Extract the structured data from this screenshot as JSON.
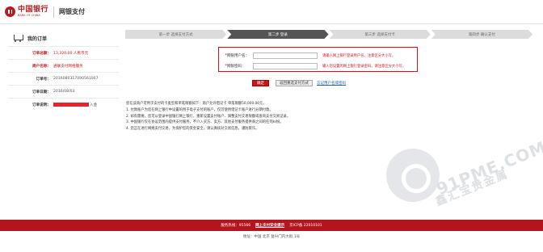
{
  "header": {
    "logo_cn": "中国银行",
    "logo_en": "BANK OF CHINA",
    "title": "网银支付"
  },
  "order": {
    "title": "我的订单",
    "rows": [
      {
        "label": "订单总额：",
        "value": "13,320.00 人民币元"
      },
      {
        "label": "商户名称：",
        "value": "通联支付网络服务"
      },
      {
        "label": "订单号：",
        "value": "2016080317090561007"
      },
      {
        "label": "订单日期：",
        "value": "2016/08/03"
      },
      {
        "label": "订单说明：",
        "value": "入金"
      }
    ]
  },
  "steps": [
    "第一步 选择支付方式",
    "第二步 登录",
    "第三步 选择支付卡",
    "第四步 确认支付"
  ],
  "login": {
    "username_label": "网银用户名：",
    "username_hint": "请输入网上银行登录用户名，注意区分大小写。",
    "password_label": "网银密码：",
    "password_hint": "输入您设置的网上银行登录密码，请注意区分大小写。",
    "confirm_label": "确定",
    "back_label": "返回重选支付方式",
    "forgot_label": "忘记用户名或密码"
  },
  "notice": [
    "您在该商户可用于支付的卡类型和单笔限额如下：商户允许借记卡 单笔限额50,000.00元。",
    "1. 付款账户为您在网上银行中设置的用于电子支付的账户，仅可使用借记卡账户进行分期付款。",
    "2. 如有需要，您可以登录中国银行网上银行，重新设置支付账户、调整支付交易限额或查询支付交易记录。",
    "3. 中国银行仅在协议范围内提供支付服务，不介入买方、卖方、其他支付服务提供商之间的任何纠纷。",
    "4. 您正在进行网络支付交易，为保护您的资金安全，请认真核对交易信息，谨防欺诈。"
  ],
  "footer": {
    "hotline": "服务热线：95566",
    "security": "网上支付安全提示",
    "icp": "京ICP备 22010101",
    "address": "地址：中国 北京 复兴门内大街 1号"
  },
  "watermark": {
    "line1": "91PME.COM",
    "line2": "鑫汇宝贵金属"
  },
  "colors": {
    "brand_red": "#b81c22",
    "footer_red": "#b4151d",
    "active_step": "#555555"
  }
}
